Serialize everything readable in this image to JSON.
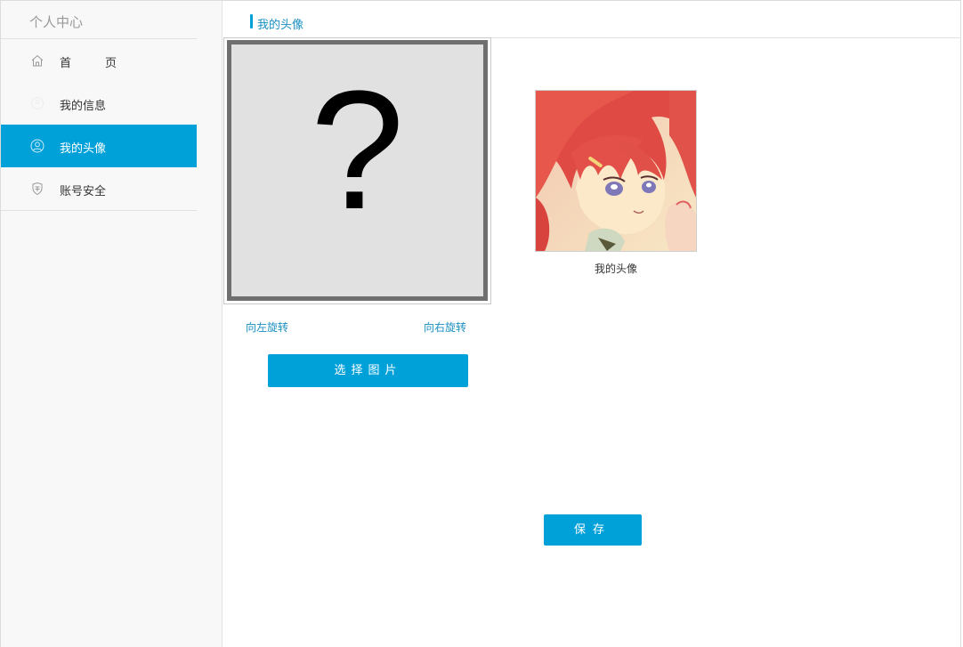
{
  "sidebar": {
    "title": "个人中心",
    "items": [
      {
        "label_a": "首",
        "label_b": "页",
        "icon": "home-icon",
        "active": false
      },
      {
        "label": "我的信息",
        "icon": "user-icon",
        "active": false
      },
      {
        "label": "我的头像",
        "icon": "avatar-icon",
        "active": true
      },
      {
        "label": "账号安全",
        "icon": "shield-icon",
        "active": false
      }
    ]
  },
  "header": {
    "title": "我的头像"
  },
  "crop": {
    "placeholder_glyph": "?",
    "rotate_left": "向左旋转",
    "rotate_right": "向右旋转",
    "select_label": "选择图片"
  },
  "preview": {
    "caption": "我的头像"
  },
  "actions": {
    "save_label": "保存"
  },
  "colors": {
    "accent": "#00a0d9",
    "link": "#1a8fc2"
  }
}
